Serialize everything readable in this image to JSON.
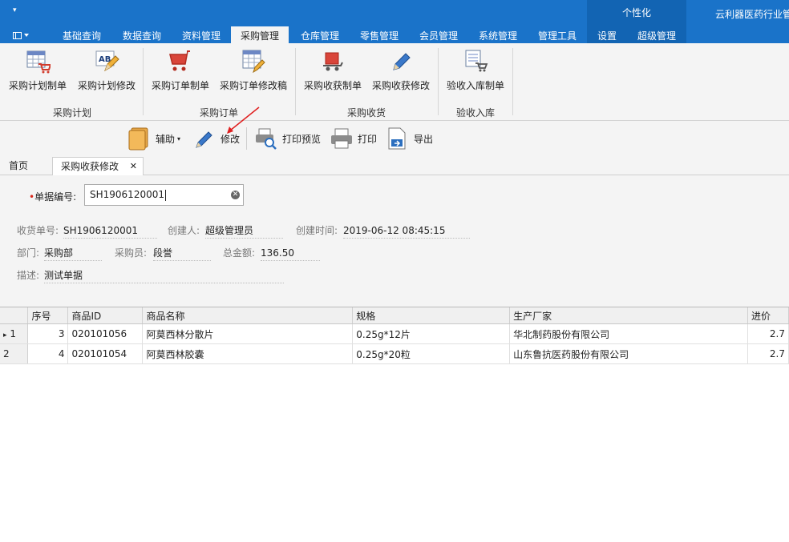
{
  "window": {
    "app_title": "云利器医药行业管",
    "context_group": "个性化",
    "qat_symbol": "▾"
  },
  "menu_tabs": [
    {
      "label": "基础查询"
    },
    {
      "label": "数据查询"
    },
    {
      "label": "资料管理"
    },
    {
      "label": "采购管理",
      "active": true
    },
    {
      "label": "仓库管理"
    },
    {
      "label": "零售管理"
    },
    {
      "label": "会员管理"
    },
    {
      "label": "系统管理"
    },
    {
      "label": "管理工具"
    },
    {
      "label": "设置"
    },
    {
      "label": "超级管理"
    }
  ],
  "ribbon": {
    "groups": [
      {
        "label": "采购计划",
        "buttons": [
          "采购计划制单",
          "采购计划修改"
        ]
      },
      {
        "label": "采购订单",
        "buttons": [
          "采购订单制单",
          "采购订单修改稿"
        ]
      },
      {
        "label": "采购收货",
        "buttons": [
          "采购收获制单",
          "采购收获修改"
        ]
      },
      {
        "label": "验收入库",
        "buttons": [
          "验收入库制单"
        ]
      }
    ]
  },
  "toolbar": {
    "assist": "辅助",
    "edit": "修改",
    "print_preview": "打印预览",
    "print": "打印",
    "export": "导出"
  },
  "doc_tabs": {
    "home": "首页",
    "current": "采购收获修改",
    "close_symbol": "✕"
  },
  "form": {
    "doc_no_label": "单据编号:",
    "doc_no_value": "SH1906120001",
    "required_mark": "•",
    "receipt_no_label": "收货单号:",
    "receipt_no": "SH1906120001",
    "creator_label": "创建人:",
    "creator": "超级管理员",
    "created_label": "创建时间:",
    "created": "2019-06-12 08:45:15",
    "dept_label": "部门:",
    "dept": "采购部",
    "buyer_label": "采购员:",
    "buyer": "段誉",
    "total_label": "总金额:",
    "total": "136.50",
    "desc_label": "描述:",
    "desc": "测试单据"
  },
  "grid": {
    "columns": [
      "序号",
      "商品ID",
      "商品名称",
      "规格",
      "生产厂家",
      "进价"
    ],
    "rows": [
      {
        "rownum": "1",
        "marker": "▸",
        "seq": "3",
        "id": "020101056",
        "name": "阿莫西林分散片",
        "spec": "0.25g*12片",
        "maker": "华北制药股份有限公司",
        "price": "2.7"
      },
      {
        "rownum": "2",
        "marker": "",
        "seq": "4",
        "id": "020101054",
        "name": "阿莫西林胶囊",
        "spec": "0.25g*20粒",
        "maker": "山东鲁抗医药股份有限公司",
        "price": "2.7"
      }
    ]
  },
  "colors": {
    "title_blue": "#1a73c9",
    "ribbon_bg": "#f4f4f4",
    "annotation_red": "#e02020"
  }
}
